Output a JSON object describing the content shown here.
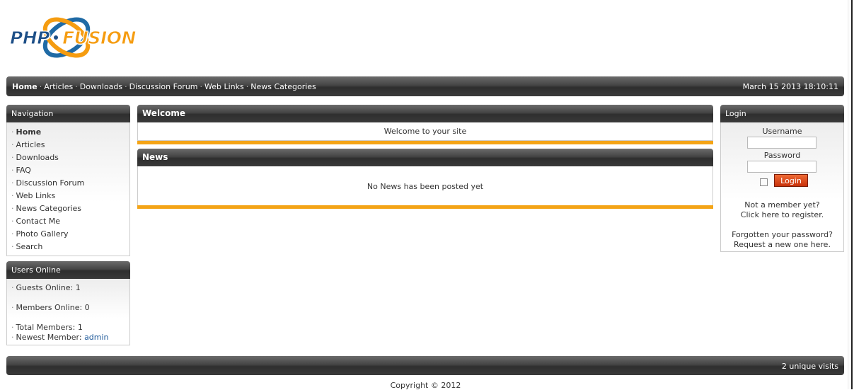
{
  "logo": {
    "part1": "PHP",
    "part2": "FUSION"
  },
  "topnav": {
    "links": [
      "Home",
      "Articles",
      "Downloads",
      "Discussion Forum",
      "Web Links",
      "News Categories"
    ],
    "datetime": "March 15 2013 18:10:11"
  },
  "navigation": {
    "title": "Navigation",
    "items": [
      "Home",
      "Articles",
      "Downloads",
      "FAQ",
      "Discussion Forum",
      "Web Links",
      "News Categories",
      "Contact Me",
      "Photo Gallery",
      "Search"
    ]
  },
  "users_online": {
    "title": "Users Online",
    "guests": "Guests Online: 1",
    "members": "Members Online: 0",
    "total": "Total Members: 1",
    "newest_label": "Newest Member:",
    "newest_name": "admin"
  },
  "welcome": {
    "title": "Welcome",
    "text": "Welcome to your site"
  },
  "news": {
    "title": "News",
    "text": "No News has been posted yet"
  },
  "login": {
    "title": "Login",
    "username_label": "Username",
    "password_label": "Password",
    "button": "Login",
    "register_line1": "Not a member yet?",
    "register_line2": "Click here to register.",
    "forgot_line1": "Forgotten your password?",
    "forgot_line2": "Request a new one here."
  },
  "footer": {
    "visits": "2 unique visits",
    "copyright": "Copyright © 2012"
  },
  "colors": {
    "accent": "#f4a416",
    "link": "#1f5a9a",
    "login_button": "#e2501f"
  }
}
